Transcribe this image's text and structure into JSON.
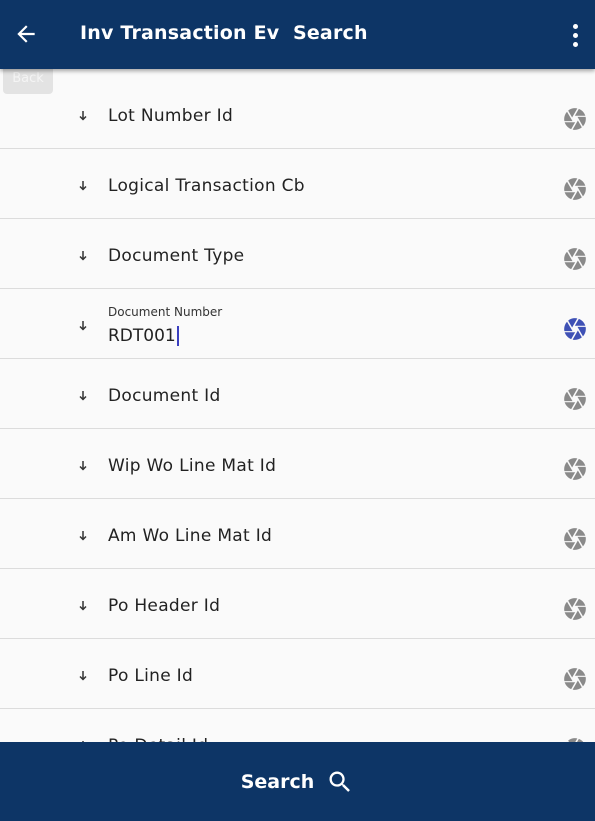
{
  "header": {
    "title": "Inv Transaction Ev  Search",
    "back_tooltip": "Back",
    "back_icon": "arrow-left-icon",
    "menu_icon": "more-vert-icon",
    "background": "#0d3566"
  },
  "fields": [
    {
      "label": "Lot Number Id"
    },
    {
      "label": "Logical Transaction Cb"
    },
    {
      "label": "Document Type"
    },
    {
      "label": "Document Number",
      "value": "RDT001",
      "active": true
    },
    {
      "label": "Document Id"
    },
    {
      "label": "Wip Wo Line Mat Id"
    },
    {
      "label": "Am Wo Line Mat Id"
    },
    {
      "label": "Po Header Id"
    },
    {
      "label": "Po Line Id"
    },
    {
      "label": "Po Detail Id"
    }
  ],
  "icons": {
    "sort": "arrow-down-icon",
    "field_option": "aperture-icon",
    "inactive_color": "#8a8a8a",
    "active_color": "#3f51b5"
  },
  "footer": {
    "search_label": "Search",
    "search_icon": "search-icon"
  }
}
